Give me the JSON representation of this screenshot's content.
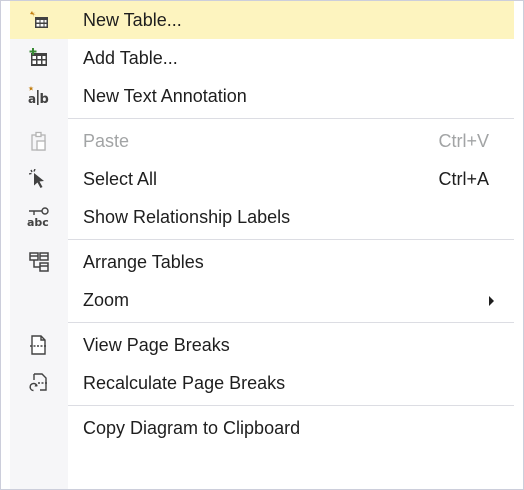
{
  "menu": {
    "items": [
      {
        "label": "New Table...",
        "icon": "new-table-icon"
      },
      {
        "label": "Add Table...",
        "icon": "add-table-icon"
      },
      {
        "label": "New Text Annotation",
        "icon": "new-text-annotation-icon"
      },
      {
        "label": "Paste",
        "shortcut": "Ctrl+V",
        "icon": "paste-icon",
        "disabled": true
      },
      {
        "label": "Select All",
        "shortcut": "Ctrl+A",
        "icon": "select-all-icon"
      },
      {
        "label": "Show Relationship Labels",
        "icon": "relationship-labels-icon"
      },
      {
        "label": "Arrange Tables",
        "icon": "arrange-tables-icon"
      },
      {
        "label": "Zoom",
        "submenu": true
      },
      {
        "label": "View Page Breaks",
        "icon": "view-page-breaks-icon"
      },
      {
        "label": "Recalculate Page Breaks",
        "icon": "recalculate-page-breaks-icon"
      },
      {
        "label": "Copy Diagram to Clipboard"
      }
    ]
  },
  "colors": {
    "highlight": "#fdf4bf",
    "gutter": "#f6f6f8",
    "text": "#1e1e1e",
    "disabled_text": "#a2a4a5",
    "icon_dark": "#424242",
    "icon_accent": "#c27d0e",
    "icon_green": "#388a34"
  }
}
